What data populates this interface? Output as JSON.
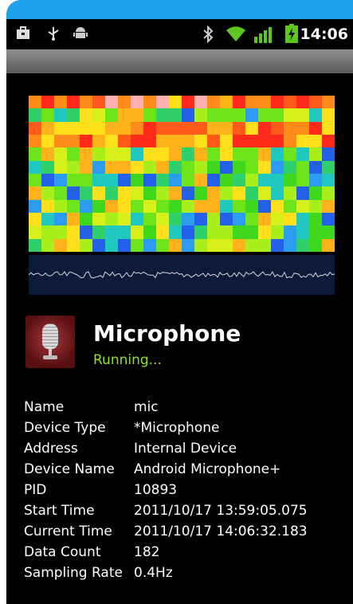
{
  "status_bar": {
    "time": "14:06",
    "icons": [
      "briefcase-icon",
      "usb-icon",
      "android-icon",
      "bluetooth-icon",
      "wifi-icon",
      "signal-icon",
      "battery-charging-icon"
    ]
  },
  "colors": {
    "accent_frame": "#1ea1ee",
    "running_green": "#8fe32b",
    "background": "#000000"
  },
  "device": {
    "title": "Microphone",
    "state": "Running...",
    "icon": "microphone-icon"
  },
  "info": [
    {
      "label": "Name",
      "value": "mic"
    },
    {
      "label": "Device Type",
      "value": "*Microphone"
    },
    {
      "label": "Address",
      "value": "Internal Device"
    },
    {
      "label": "Device Name",
      "value": "Android Microphone+"
    },
    {
      "label": "PID",
      "value": "10893"
    },
    {
      "label": "Start Time",
      "value": "2011/10/17 13:59:05.075"
    },
    {
      "label": "Current Time",
      "value": "2011/10/17 14:06:32.183"
    },
    {
      "label": "Data Count",
      "value": "182"
    },
    {
      "label": "Sampling Rate",
      "value": "0.4Hz"
    }
  ]
}
